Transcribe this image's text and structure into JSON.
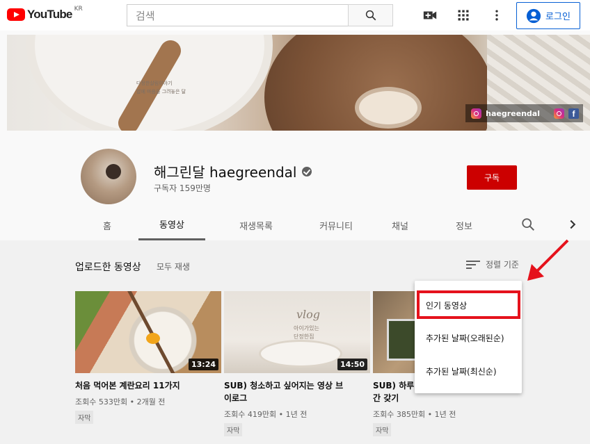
{
  "header": {
    "logo_text": "YouTube",
    "region": "KR",
    "search_placeholder": "검색",
    "login_label": "로그인",
    "icons": [
      "search-icon",
      "video-camera-icon",
      "apps-grid-icon",
      "more-vert-icon",
      "account-icon"
    ]
  },
  "banner": {
    "caption_line1": "다정한살림이야기",
    "caption_line2": "밥에 마음을 그려놓은 달",
    "social_handle": "haegreendal"
  },
  "channel": {
    "name": "해그린달 haegreendal",
    "subscribers": "구독자 159만명",
    "subscribe_label": "구독",
    "tabs": [
      {
        "label": "홈",
        "active": false
      },
      {
        "label": "동영상",
        "active": true
      },
      {
        "label": "재생목록",
        "active": false
      },
      {
        "label": "커뮤니티",
        "active": false
      },
      {
        "label": "채널",
        "active": false
      },
      {
        "label": "정보",
        "active": false
      }
    ]
  },
  "uploads": {
    "section_title": "업로드한 동영상",
    "play_all": "모두 재생",
    "sort_label": "정렬 기준",
    "videos": [
      {
        "title": "처음 먹어본 계란요리 11가지",
        "title_line2": "",
        "meta": "조회수 533만회 • 2개월 전",
        "badge": "자막",
        "duration": "13:24"
      },
      {
        "title": "SUB) 청소하고 싶어지는 영상 브",
        "title_line2": "이로그",
        "meta": "조회수 419만회 • 1년 전",
        "badge": "자막",
        "duration": "14:50"
      },
      {
        "title": "SUB) 하루",
        "title_line2": "간 갖기",
        "meta": "조회수 385만회 • 1년 전",
        "badge": "자막",
        "duration": ""
      }
    ],
    "thumb2_text": "vlog",
    "thumb2_sub1": "아이가있는",
    "thumb2_sub2": "단정한집"
  },
  "sort_menu": {
    "items": [
      "인기 동영상",
      "추가된 날짜(오래된순)",
      "추가된 날짜(최신순)"
    ],
    "highlighted_index": 0
  },
  "colors": {
    "brand_red": "#ff0000",
    "subscribe_red": "#cc0000",
    "login_blue": "#065fd4",
    "annotation_red": "#e5121c"
  }
}
